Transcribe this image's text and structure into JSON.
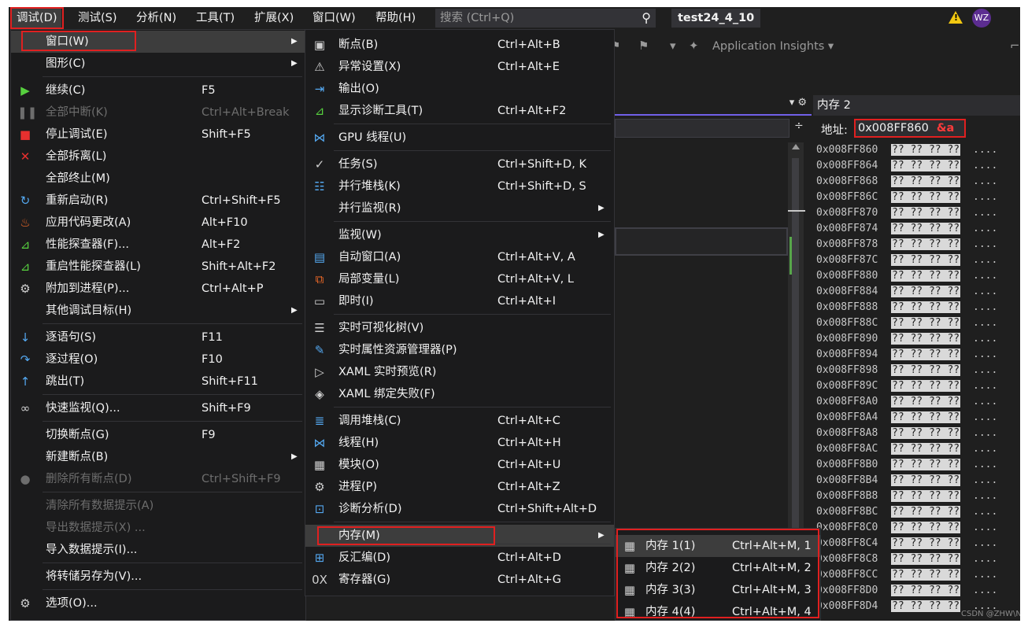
{
  "menubar": {
    "items": [
      "调试(D)",
      "测试(S)",
      "分析(N)",
      "工具(T)",
      "扩展(X)",
      "窗口(W)",
      "帮助(H)"
    ],
    "search_placeholder": "搜索 (Ctrl+Q)",
    "solution_name": "test24_4_10",
    "user_initials": "WZ"
  },
  "toolbar": {
    "app_insights": "Application Insights ▾"
  },
  "memory_window": {
    "title": "内存 2",
    "address_label": "地址:",
    "address_value": "0x008FF860",
    "address_expr": "&a",
    "rows": [
      {
        "addr": "0x008FF860",
        "bytes": "?? ?? ?? ??",
        "chars": "...."
      },
      {
        "addr": "0x008FF864",
        "bytes": "?? ?? ?? ??",
        "chars": "...."
      },
      {
        "addr": "0x008FF868",
        "bytes": "?? ?? ?? ??",
        "chars": "...."
      },
      {
        "addr": "0x008FF86C",
        "bytes": "?? ?? ?? ??",
        "chars": "...."
      },
      {
        "addr": "0x008FF870",
        "bytes": "?? ?? ?? ??",
        "chars": "...."
      },
      {
        "addr": "0x008FF874",
        "bytes": "?? ?? ?? ??",
        "chars": "...."
      },
      {
        "addr": "0x008FF878",
        "bytes": "?? ?? ?? ??",
        "chars": "...."
      },
      {
        "addr": "0x008FF87C",
        "bytes": "?? ?? ?? ??",
        "chars": "...."
      },
      {
        "addr": "0x008FF880",
        "bytes": "?? ?? ?? ??",
        "chars": "...."
      },
      {
        "addr": "0x008FF884",
        "bytes": "?? ?? ?? ??",
        "chars": "...."
      },
      {
        "addr": "0x008FF888",
        "bytes": "?? ?? ?? ??",
        "chars": "...."
      },
      {
        "addr": "0x008FF88C",
        "bytes": "?? ?? ?? ??",
        "chars": "...."
      },
      {
        "addr": "0x008FF890",
        "bytes": "?? ?? ?? ??",
        "chars": "...."
      },
      {
        "addr": "0x008FF894",
        "bytes": "?? ?? ?? ??",
        "chars": "...."
      },
      {
        "addr": "0x008FF898",
        "bytes": "?? ?? ?? ??",
        "chars": "...."
      },
      {
        "addr": "0x008FF89C",
        "bytes": "?? ?? ?? ??",
        "chars": "...."
      },
      {
        "addr": "0x008FF8A0",
        "bytes": "?? ?? ?? ??",
        "chars": "...."
      },
      {
        "addr": "0x008FF8A4",
        "bytes": "?? ?? ?? ??",
        "chars": "...."
      },
      {
        "addr": "0x008FF8A8",
        "bytes": "?? ?? ?? ??",
        "chars": "...."
      },
      {
        "addr": "0x008FF8AC",
        "bytes": "?? ?? ?? ??",
        "chars": "...."
      },
      {
        "addr": "0x008FF8B0",
        "bytes": "?? ?? ?? ??",
        "chars": "...."
      },
      {
        "addr": "0x008FF8B4",
        "bytes": "?? ?? ?? ??",
        "chars": "...."
      },
      {
        "addr": "0x008FF8B8",
        "bytes": "?? ?? ?? ??",
        "chars": "...."
      },
      {
        "addr": "0x008FF8BC",
        "bytes": "?? ?? ?? ??",
        "chars": "...."
      },
      {
        "addr": "0x008FF8C0",
        "bytes": "?? ?? ?? ??",
        "chars": "...."
      },
      {
        "addr": "0x008FF8C4",
        "bytes": "?? ?? ?? ??",
        "chars": "...."
      },
      {
        "addr": "0x008FF8C8",
        "bytes": "?? ?? ?? ??",
        "chars": "...."
      },
      {
        "addr": "0x008FF8CC",
        "bytes": "?? ?? ?? ??",
        "chars": "...."
      },
      {
        "addr": "0x008FF8D0",
        "bytes": "?? ?? ?? ??",
        "chars": "...."
      },
      {
        "addr": "0x008FF8D4",
        "bytes": "?? ?? ?? ??",
        "chars": "...."
      }
    ]
  },
  "debug_menu": {
    "items": [
      {
        "label": "窗口(W)",
        "shortcut": "",
        "submenu": true,
        "icon": "",
        "disabled": false,
        "highlight": true
      },
      {
        "label": "图形(C)",
        "shortcut": "",
        "submenu": true,
        "icon": "",
        "disabled": false
      },
      {
        "label": "继续(C)",
        "shortcut": "F5",
        "icon": "play-icon",
        "disabled": false
      },
      {
        "label": "全部中断(K)",
        "shortcut": "Ctrl+Alt+Break",
        "icon": "pause-icon",
        "disabled": true
      },
      {
        "label": "停止调试(E)",
        "shortcut": "Shift+F5",
        "icon": "stop-icon",
        "disabled": false
      },
      {
        "label": "全部拆离(L)",
        "shortcut": "",
        "icon": "detach-icon",
        "disabled": false
      },
      {
        "label": "全部终止(M)",
        "shortcut": "",
        "icon": "",
        "disabled": false
      },
      {
        "label": "重新启动(R)",
        "shortcut": "Ctrl+Shift+F5",
        "icon": "restart-icon",
        "disabled": false
      },
      {
        "label": "应用代码更改(A)",
        "shortcut": "Alt+F10",
        "icon": "hot-reload-icon",
        "disabled": false
      },
      {
        "label": "性能探查器(F)...",
        "shortcut": "Alt+F2",
        "icon": "profiler-icon",
        "disabled": false
      },
      {
        "label": "重启性能探查器(L)",
        "shortcut": "Shift+Alt+F2",
        "icon": "profiler-icon",
        "disabled": false
      },
      {
        "label": "附加到进程(P)...",
        "shortcut": "Ctrl+Alt+P",
        "icon": "attach-icon",
        "disabled": false
      },
      {
        "label": "其他调试目标(H)",
        "shortcut": "",
        "submenu": true,
        "icon": "",
        "disabled": false
      },
      {
        "label": "逐语句(S)",
        "shortcut": "F11",
        "icon": "step-into-icon",
        "disabled": false
      },
      {
        "label": "逐过程(O)",
        "shortcut": "F10",
        "icon": "step-over-icon",
        "disabled": false
      },
      {
        "label": "跳出(T)",
        "shortcut": "Shift+F11",
        "icon": "step-out-icon",
        "disabled": false
      },
      {
        "label": "快速监视(Q)...",
        "shortcut": "Shift+F9",
        "icon": "glasses-icon",
        "disabled": false
      },
      {
        "label": "切换断点(G)",
        "shortcut": "F9",
        "icon": "",
        "disabled": false
      },
      {
        "label": "新建断点(B)",
        "shortcut": "",
        "submenu": true,
        "icon": "",
        "disabled": false
      },
      {
        "label": "删除所有断点(D)",
        "shortcut": "Ctrl+Shift+F9",
        "icon": "delete-breakpoints-icon",
        "disabled": true
      },
      {
        "label": "清除所有数据提示(A)",
        "shortcut": "",
        "icon": "",
        "disabled": true
      },
      {
        "label": "导出数据提示(X) ...",
        "shortcut": "",
        "icon": "",
        "disabled": true
      },
      {
        "label": "导入数据提示(I)...",
        "shortcut": "",
        "icon": "",
        "disabled": false
      },
      {
        "label": "将转储另存为(V)...",
        "shortcut": "",
        "icon": "",
        "disabled": false
      },
      {
        "label": "选项(O)...",
        "shortcut": "",
        "icon": "gear-icon",
        "disabled": false
      }
    ]
  },
  "window_menu": {
    "items": [
      {
        "label": "断点(B)",
        "shortcut": "Ctrl+Alt+B",
        "icon": "breakpoints-icon"
      },
      {
        "label": "异常设置(X)",
        "shortcut": "Ctrl+Alt+E",
        "icon": "exception-settings-icon"
      },
      {
        "label": "输出(O)",
        "shortcut": "",
        "icon": "output-icon"
      },
      {
        "label": "显示诊断工具(T)",
        "shortcut": "Ctrl+Alt+F2",
        "icon": "diagnostic-tools-icon"
      },
      {
        "label": "GPU 线程(U)",
        "shortcut": "",
        "icon": "gpu-threads-icon"
      },
      {
        "label": "任务(S)",
        "shortcut": "Ctrl+Shift+D, K",
        "icon": "tasks-icon"
      },
      {
        "label": "并行堆栈(K)",
        "shortcut": "Ctrl+Shift+D, S",
        "icon": "parallel-stacks-icon"
      },
      {
        "label": "并行监视(R)",
        "shortcut": "",
        "submenu": true,
        "icon": ""
      },
      {
        "label": "监视(W)",
        "shortcut": "",
        "submenu": true,
        "icon": ""
      },
      {
        "label": "自动窗口(A)",
        "shortcut": "Ctrl+Alt+V, A",
        "icon": "autos-icon"
      },
      {
        "label": "局部变量(L)",
        "shortcut": "Ctrl+Alt+V, L",
        "icon": "locals-icon"
      },
      {
        "label": "即时(I)",
        "shortcut": "Ctrl+Alt+I",
        "icon": "immediate-icon"
      },
      {
        "label": "实时可视化树(V)",
        "shortcut": "",
        "icon": "visual-tree-icon"
      },
      {
        "label": "实时属性资源管理器(P)",
        "shortcut": "",
        "icon": "property-explorer-icon"
      },
      {
        "label": "XAML 实时预览(R)",
        "shortcut": "",
        "icon": "xaml-preview-icon"
      },
      {
        "label": "XAML 绑定失败(F)",
        "shortcut": "",
        "icon": "xaml-binding-icon"
      },
      {
        "label": "调用堆栈(C)",
        "shortcut": "Ctrl+Alt+C",
        "icon": "call-stack-icon"
      },
      {
        "label": "线程(H)",
        "shortcut": "Ctrl+Alt+H",
        "icon": "threads-icon"
      },
      {
        "label": "模块(O)",
        "shortcut": "Ctrl+Alt+U",
        "icon": "modules-icon"
      },
      {
        "label": "进程(P)",
        "shortcut": "Ctrl+Alt+Z",
        "icon": "processes-icon"
      },
      {
        "label": "诊断分析(D)",
        "shortcut": "Ctrl+Shift+Alt+D",
        "icon": "diagnostic-analysis-icon"
      },
      {
        "label": "内存(M)",
        "shortcut": "",
        "submenu": true,
        "icon": "",
        "highlight": true
      },
      {
        "label": "反汇编(D)",
        "shortcut": "Ctrl+Alt+D",
        "icon": "disassembly-icon"
      },
      {
        "label": "寄存器(G)",
        "shortcut": "Ctrl+Alt+G",
        "icon": "registers-icon"
      }
    ]
  },
  "memory_menu": {
    "items": [
      {
        "label": "内存 1(1)",
        "shortcut": "Ctrl+Alt+M, 1",
        "icon": "memory-chip-icon",
        "highlight": true
      },
      {
        "label": "内存 2(2)",
        "shortcut": "Ctrl+Alt+M, 2",
        "icon": "memory-chip-icon"
      },
      {
        "label": "内存 3(3)",
        "shortcut": "Ctrl+Alt+M, 3",
        "icon": "memory-chip-icon"
      },
      {
        "label": "内存 4(4)",
        "shortcut": "Ctrl+Alt+M, 4",
        "icon": "memory-chip-icon"
      }
    ]
  },
  "watermark": "CSDN @ZHW\\N"
}
